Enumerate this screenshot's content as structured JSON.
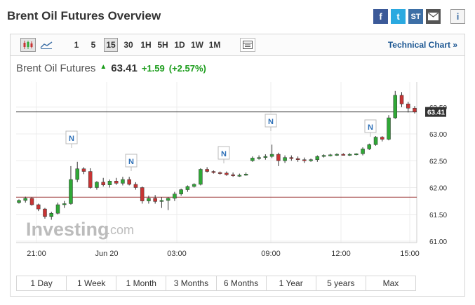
{
  "page": {
    "title": "Brent Oil Futures Overview"
  },
  "share": {
    "facebook": "f",
    "twitter": "t",
    "stocktwits": "ST",
    "email_icon": "envelope-icon",
    "info": "i"
  },
  "toolbar": {
    "candle_icon": "candlestick-icon",
    "line_icon": "line-chart-icon",
    "intervals": [
      "1",
      "5",
      "15",
      "30",
      "1H",
      "5H",
      "1D",
      "1W",
      "1M"
    ],
    "active_interval": "15",
    "table_icon": "table-icon",
    "technical_link": "Technical Chart »"
  },
  "quote": {
    "name": "Brent Oil Futures",
    "price": "63.41",
    "change": "+1.59",
    "change_pct": "(+2.57%)",
    "up_color": "#1a9c1a"
  },
  "chart_data": {
    "type": "candlestick",
    "title": "",
    "y_ticks": [
      "63.50",
      "63.00",
      "62.50",
      "62.00",
      "61.50",
      "61.00"
    ],
    "ylim": [
      61.0,
      63.9
    ],
    "x_tick_labels": [
      "21:00",
      "Jun 20",
      "03:00",
      "09:00",
      "12:00",
      "15:00"
    ],
    "current_price_label": "63.41",
    "current_price": 63.41,
    "prev_close": 61.82,
    "watermark": "Investing.com",
    "news_markers": [
      "N",
      "N",
      "N",
      "N",
      "N"
    ],
    "up_color": "#2fa836",
    "down_color": "#c83434",
    "candles": [
      [
        61.72,
        61.78,
        61.7,
        61.76
      ],
      [
        61.76,
        61.83,
        61.72,
        61.8
      ],
      [
        61.8,
        61.82,
        61.66,
        61.68
      ],
      [
        61.68,
        61.7,
        61.56,
        61.6
      ],
      [
        61.6,
        61.62,
        61.42,
        61.46
      ],
      [
        61.46,
        61.55,
        61.4,
        61.52
      ],
      [
        61.52,
        61.72,
        61.5,
        61.68
      ],
      [
        61.68,
        61.75,
        61.62,
        61.7
      ],
      [
        61.7,
        62.4,
        61.68,
        62.15
      ],
      [
        62.15,
        62.48,
        62.1,
        62.35
      ],
      [
        62.35,
        62.38,
        62.25,
        62.3
      ],
      [
        62.3,
        62.36,
        61.98,
        62.0
      ],
      [
        62.0,
        62.12,
        61.96,
        62.1
      ],
      [
        62.1,
        62.18,
        62.02,
        62.05
      ],
      [
        62.05,
        62.15,
        62.0,
        62.12
      ],
      [
        62.12,
        62.18,
        62.05,
        62.08
      ],
      [
        62.08,
        62.2,
        62.04,
        62.15
      ],
      [
        62.15,
        62.2,
        62.04,
        62.06
      ],
      [
        62.06,
        62.1,
        61.96,
        62.0
      ],
      [
        62.0,
        62.02,
        61.7,
        61.75
      ],
      [
        61.75,
        61.85,
        61.7,
        61.8
      ],
      [
        61.8,
        61.86,
        61.7,
        61.74
      ],
      [
        61.74,
        61.82,
        61.62,
        61.76
      ],
      [
        61.76,
        61.82,
        61.58,
        61.8
      ],
      [
        61.8,
        61.92,
        61.75,
        61.88
      ],
      [
        61.88,
        61.98,
        61.85,
        61.96
      ],
      [
        61.96,
        62.04,
        61.92,
        62.02
      ],
      [
        62.02,
        62.08,
        62.0,
        62.06
      ],
      [
        62.06,
        62.36,
        62.04,
        62.34
      ],
      [
        62.34,
        62.38,
        62.28,
        62.3
      ],
      [
        62.3,
        62.32,
        62.26,
        62.28
      ],
      [
        62.28,
        62.3,
        62.24,
        62.27
      ],
      [
        62.27,
        62.3,
        62.22,
        62.24
      ],
      [
        62.24,
        62.28,
        62.2,
        62.22
      ],
      [
        62.22,
        62.26,
        62.2,
        62.23
      ],
      [
        62.23,
        62.28,
        62.22,
        62.25
      ],
      [
        62.5,
        62.58,
        62.48,
        62.55
      ],
      [
        62.55,
        62.6,
        62.52,
        62.56
      ],
      [
        62.56,
        62.62,
        62.52,
        62.58
      ],
      [
        62.58,
        62.8,
        62.55,
        62.62
      ],
      [
        62.62,
        62.65,
        62.4,
        62.5
      ],
      [
        62.5,
        62.6,
        62.46,
        62.56
      ],
      [
        62.56,
        62.6,
        62.5,
        62.54
      ],
      [
        62.54,
        62.58,
        62.48,
        62.52
      ],
      [
        62.52,
        62.56,
        62.46,
        62.5
      ],
      [
        62.5,
        62.54,
        62.48,
        62.52
      ],
      [
        62.52,
        62.6,
        62.48,
        62.58
      ],
      [
        62.58,
        62.62,
        62.56,
        62.6
      ],
      [
        62.6,
        62.63,
        62.58,
        62.61
      ],
      [
        62.61,
        62.64,
        62.59,
        62.62
      ],
      [
        62.62,
        62.64,
        62.6,
        62.61
      ],
      [
        62.61,
        62.64,
        62.59,
        62.62
      ],
      [
        62.62,
        62.64,
        62.6,
        62.63
      ],
      [
        62.63,
        62.75,
        62.6,
        62.72
      ],
      [
        62.72,
        62.82,
        62.7,
        62.8
      ],
      [
        62.8,
        62.96,
        62.78,
        62.94
      ],
      [
        62.94,
        62.96,
        62.86,
        62.9
      ],
      [
        62.9,
        63.35,
        62.88,
        63.3
      ],
      [
        63.3,
        63.8,
        63.28,
        63.72
      ],
      [
        63.72,
        63.78,
        63.5,
        63.56
      ],
      [
        63.56,
        63.6,
        63.4,
        63.48
      ],
      [
        63.48,
        63.52,
        63.38,
        63.41
      ]
    ]
  },
  "ranges": [
    "1 Day",
    "1 Week",
    "1 Month",
    "3 Months",
    "6 Months",
    "1 Year",
    "5 years",
    "Max"
  ]
}
